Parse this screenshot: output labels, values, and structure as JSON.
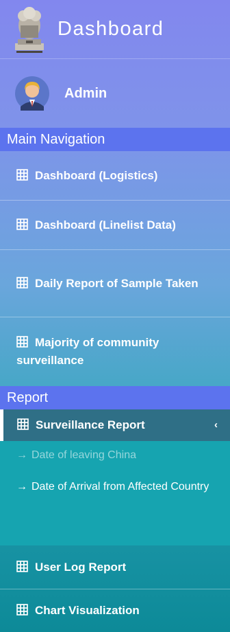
{
  "brand": {
    "title": "Dashboard"
  },
  "user": {
    "name": "Admin"
  },
  "sections": {
    "main": "Main Navigation",
    "report": "Report"
  },
  "main_nav": [
    {
      "label": "Dashboard (Logistics)",
      "icon": "grid-icon"
    },
    {
      "label": "Dashboard (Linelist Data)",
      "icon": "grid-icon"
    },
    {
      "label": "Daily Report of Sample Taken",
      "icon": "grid-icon"
    },
    {
      "label": "Majority of community surveillance",
      "icon": "grid-icon"
    }
  ],
  "report_nav": {
    "surveillance": {
      "label": "Surveillance Report",
      "chevron": "‹",
      "icon": "grid-icon"
    },
    "sub_items": [
      {
        "arrow": "→",
        "label": "Date of leaving China"
      },
      {
        "arrow": "→",
        "label": "Date of Arrival from Affected Country"
      }
    ],
    "user_log": {
      "label": "User Log Report",
      "icon": "grid-icon"
    },
    "chart_vis": {
      "label": "Chart Visualization",
      "icon": "grid-icon"
    }
  },
  "colors": {
    "section_header": "#5c73ee",
    "active_item": "#2f6f86",
    "submenu_bg": "#16a4b0"
  }
}
